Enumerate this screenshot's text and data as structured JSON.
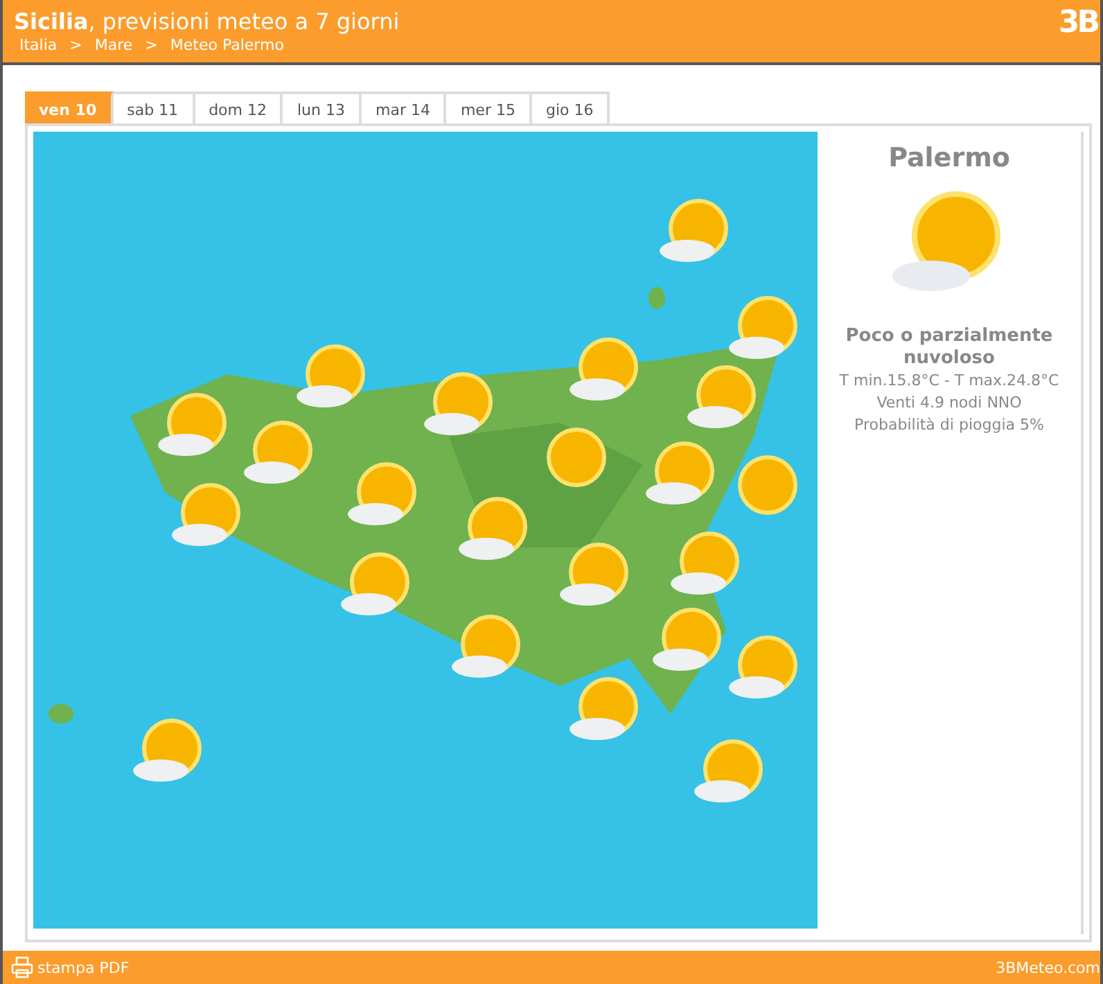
{
  "header": {
    "title_bold": "Sicilia",
    "title_rest": ", previsioni meteo a 7 giorni",
    "breadcrumb": [
      "Italia",
      "Mare",
      "Meteo Palermo"
    ],
    "separator": ">",
    "logo": "3B"
  },
  "tabs": [
    {
      "label": "ven 10",
      "selected": true
    },
    {
      "label": "sab 11",
      "selected": false
    },
    {
      "label": "dom 12",
      "selected": false
    },
    {
      "label": "lun 13",
      "selected": false
    },
    {
      "label": "mar 14",
      "selected": false
    },
    {
      "label": "mer 15",
      "selected": false
    },
    {
      "label": "gio 16",
      "selected": false
    }
  ],
  "forecast": {
    "city": "Palermo",
    "condition": "Poco o parzialmente nuvoloso",
    "temperature": "T min.15.8°C - T max.24.8°C",
    "wind": "Venti 4.9 nodi NNO",
    "rain": "Probabilità di pioggia 5%"
  },
  "footer": {
    "print": "stampa PDF",
    "site": "3BMeteo.com"
  }
}
